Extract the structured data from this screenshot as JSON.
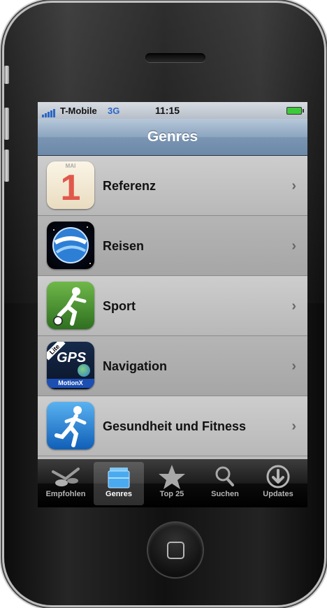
{
  "status_bar": {
    "carrier": "T-Mobile",
    "network": "3G",
    "time": "11:15"
  },
  "nav": {
    "title": "Genres"
  },
  "rows": [
    {
      "label": "Referenz",
      "icon": "calendar-icon",
      "icon_text": "1",
      "icon_subtext": "MAI"
    },
    {
      "label": "Reisen",
      "icon": "globe-icon"
    },
    {
      "label": "Sport",
      "icon": "soccer-player-icon"
    },
    {
      "label": "Navigation",
      "icon": "gps-app-icon",
      "icon_text": "GPS",
      "icon_badge": "Lite",
      "icon_subtext": "MotionX"
    },
    {
      "label": "Gesundheit und Fitness",
      "icon": "runner-icon"
    }
  ],
  "chevron": "›",
  "tabs": [
    {
      "label": "Empfohlen",
      "icon": "featured-icon",
      "active": false
    },
    {
      "label": "Genres",
      "icon": "genres-icon",
      "active": true
    },
    {
      "label": "Top 25",
      "icon": "star-icon",
      "active": false
    },
    {
      "label": "Suchen",
      "icon": "search-icon",
      "active": false
    },
    {
      "label": "Updates",
      "icon": "download-icon",
      "active": false
    }
  ],
  "colors": {
    "nav_bar": "#7a95b3",
    "network_blue": "#2a67c5",
    "battery_green": "#3ec93c",
    "tab_bar": "#000000"
  }
}
